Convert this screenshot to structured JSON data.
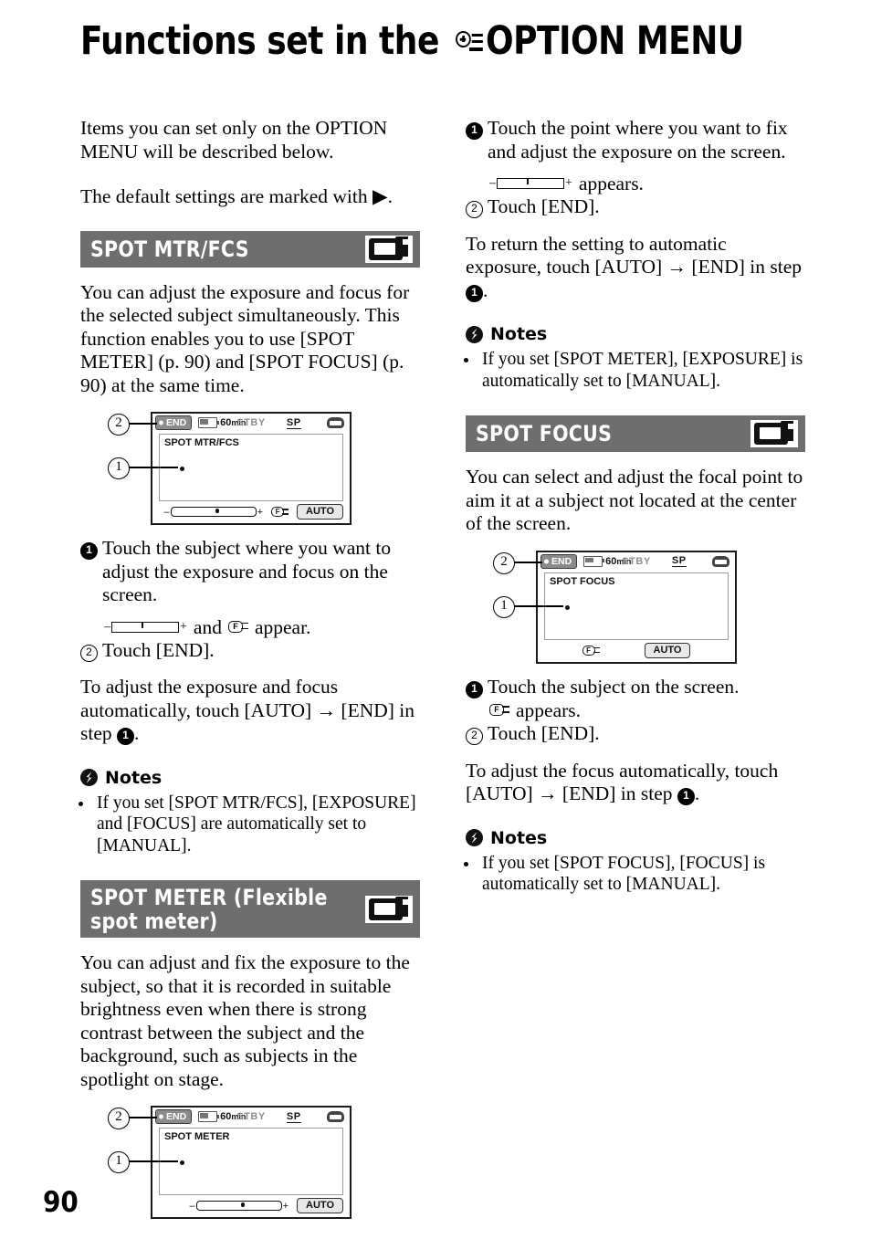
{
  "page": {
    "title_before_icon": "Functions set in the",
    "title_after_icon": "OPTION MENU",
    "option_menu_icon": "option-menu-icon",
    "page_number": "90"
  },
  "intro": {
    "paragraph_1": "Items you can set only on the OPTION MENU will be described below.",
    "paragraph_2_a": "The default settings are marked with",
    "paragraph_2_marker": "▶",
    "paragraph_2_b": "."
  },
  "sections": {
    "spot_mtr_fcs": {
      "heading": "SPOT MTR/FCS",
      "icon": "camcorder-icon",
      "description": "You can adjust the exposure and focus for the selected subject simultaneously. This function enables you to use [SPOT METER] (p. 90) and [SPOT FOCUS] (p. 90) at the same time.",
      "lcd": {
        "end_button": "END",
        "battery_time": "60",
        "battery_unit": "min",
        "status": "STBY",
        "rec_mode": "SP",
        "screen_label": "SPOT MTR/FCS",
        "auto_button": "AUTO",
        "has_slider": true,
        "has_focus_icon": true,
        "callout_top": "2",
        "callout_left": "1"
      },
      "step_1_num": "1",
      "step_1": "Touch the subject where you want to adjust the exposure and focus on the screen.",
      "appears_mid": "and",
      "appears_tail": "appear.",
      "step_2_num": "2",
      "step_2": "Touch [END].",
      "closing_a": "To adjust the exposure and focus automatically, touch [AUTO]",
      "closing_arrow": "→",
      "closing_b": "[END] in step",
      "closing_step": "1",
      "closing_c": ".",
      "notes_heading": "Notes",
      "notes": [
        "If you set [SPOT MTR/FCS], [EXPOSURE] and [FOCUS] are automatically set to [MANUAL]."
      ]
    },
    "spot_meter": {
      "heading_line1": "SPOT METER (Flexible",
      "heading_line2": "spot meter)",
      "icon": "camcorder-icon",
      "description": "You can adjust and fix the exposure to the subject, so that it is recorded in suitable brightness even when there is strong contrast between the subject and the background, such as subjects in the spotlight on stage.",
      "lcd": {
        "end_button": "END",
        "battery_time": "60",
        "battery_unit": "min",
        "status": "STBY",
        "rec_mode": "SP",
        "screen_label": "SPOT METER",
        "auto_button": "AUTO",
        "has_slider": true,
        "has_focus_icon": false,
        "callout_top": "2",
        "callout_left": "1"
      },
      "step_1_num": "1",
      "step_1": "Touch the point where you want to fix and adjust the exposure on the screen.",
      "appears_tail": "appears.",
      "step_2_num": "2",
      "step_2": "Touch [END].",
      "closing_a": "To return the setting to automatic exposure, touch [AUTO]",
      "closing_arrow": "→",
      "closing_b": "[END] in step",
      "closing_step": "1",
      "closing_c": ".",
      "notes_heading": "Notes",
      "notes": [
        "If you set [SPOT METER], [EXPOSURE] is automatically set to [MANUAL]."
      ]
    },
    "spot_focus": {
      "heading": "SPOT FOCUS",
      "icon": "camcorder-icon",
      "description": "You can select and adjust the focal point to aim it at a subject not located at the center of the screen.",
      "lcd": {
        "end_button": "END",
        "battery_time": "60",
        "battery_unit": "min",
        "status": "STBY",
        "rec_mode": "SP",
        "screen_label": "SPOT FOCUS",
        "auto_button": "AUTO",
        "has_slider": false,
        "has_focus_icon": true,
        "callout_top": "2",
        "callout_left": "1"
      },
      "step_1_num": "1",
      "step_1": "Touch the subject on the screen.",
      "appears_tail": "appears.",
      "step_2_num": "2",
      "step_2": "Touch [END].",
      "closing_a": "To adjust the focus automatically, touch [AUTO]",
      "closing_arrow": "→",
      "closing_b": "[END] in step",
      "closing_step": "1",
      "closing_c": ".",
      "notes_heading": "Notes",
      "notes": [
        "If you set [SPOT FOCUS], [FOCUS] is automatically set to [MANUAL]."
      ]
    }
  },
  "icon_labels": {
    "focus_glyph": "F"
  }
}
